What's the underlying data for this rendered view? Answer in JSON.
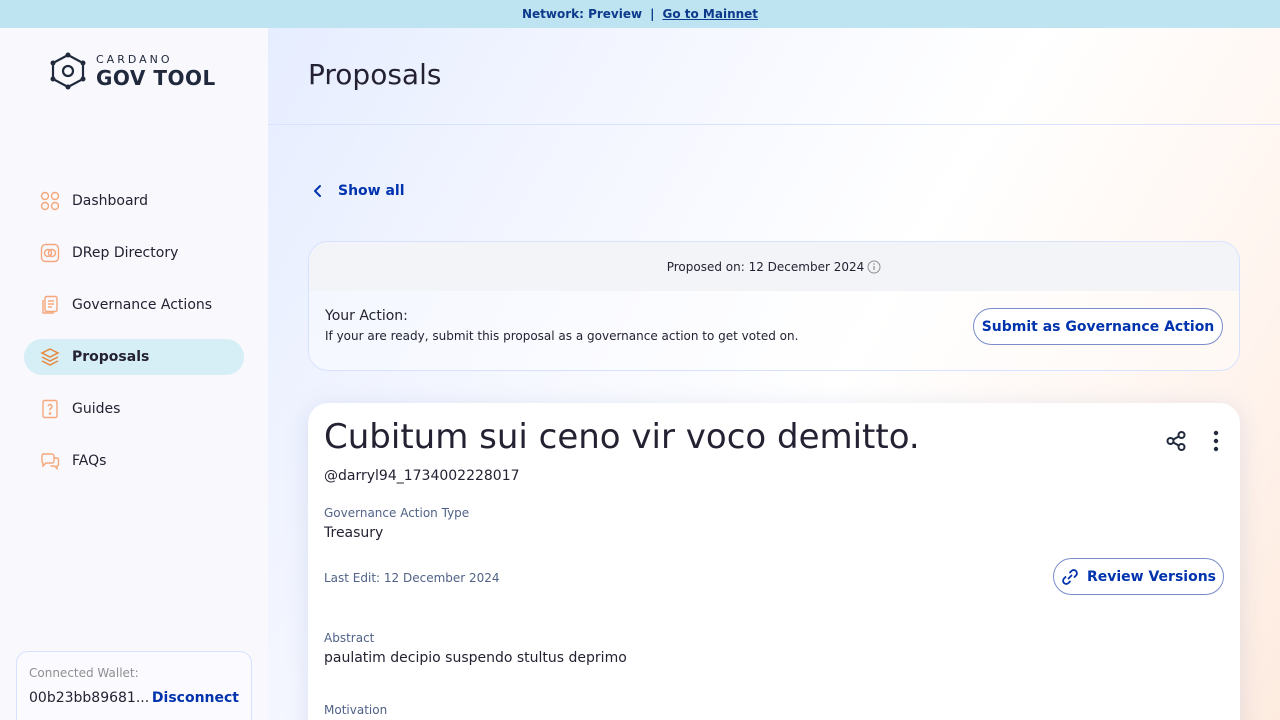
{
  "banner": {
    "network": "Network: Preview",
    "separator": "|",
    "link": "Go to Mainnet"
  },
  "brand": {
    "small": "CARDANO",
    "big": "GOV TOOL"
  },
  "nav": [
    {
      "label": "Dashboard",
      "icon": "dashboard-icon"
    },
    {
      "label": "DRep Directory",
      "icon": "drep-directory-icon"
    },
    {
      "label": "Governance Actions",
      "icon": "governance-actions-icon"
    },
    {
      "label": "Proposals",
      "icon": "proposals-icon",
      "active": true
    },
    {
      "label": "Guides",
      "icon": "guides-icon"
    },
    {
      "label": "FAQs",
      "icon": "faqs-icon"
    }
  ],
  "wallet": {
    "label": "Connected Wallet:",
    "address": "00b23bb89681...",
    "disconnect": "Disconnect"
  },
  "header": {
    "title": "Proposals"
  },
  "back": {
    "label": "Show all"
  },
  "action_card": {
    "proposed_on": "Proposed on: 12 December 2024",
    "your_action_title": "Your Action:",
    "your_action_text": "If your are ready, submit this proposal as a governance action to get voted on.",
    "submit_button": "Submit as Governance Action"
  },
  "proposal": {
    "title": "Cubitum sui ceno vir voco demitto.",
    "author": "@darryl94_1734002228017",
    "type_label": "Governance Action Type",
    "type_value": "Treasury",
    "last_edit": "Last Edit: 12 December 2024",
    "review_button": "Review Versions",
    "abstract_label": "Abstract",
    "abstract_value": "paulatim decipio suspendo stultus deprimo",
    "motivation_label": "Motivation"
  },
  "colors": {
    "accent": "#0033AD",
    "banner_bg": "#BDE4F0",
    "active_nav_bg": "#D6EEF5",
    "icon_orange": "#F5A77B"
  }
}
